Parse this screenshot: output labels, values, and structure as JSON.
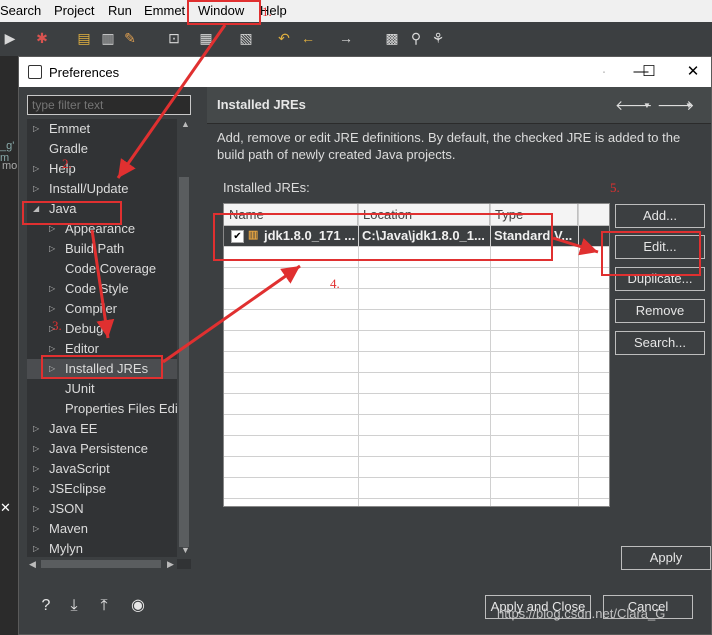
{
  "menubar": {
    "items": [
      "Search",
      "Project",
      "Run",
      "Emmet",
      "Window",
      "Help"
    ]
  },
  "toolbar": {
    "icons": [
      "debug-icon",
      "open-icon",
      "pencil-icon",
      "back-icon",
      "forward-icon",
      "pin-icon"
    ]
  },
  "ide_left": {
    "label_1": "_g' m",
    "label_2": "mo"
  },
  "dialog": {
    "title": "Preferences",
    "filter_placeholder": "type filter text",
    "tree": [
      {
        "label": "Emmet",
        "expand": "▷"
      },
      {
        "label": "Gradle",
        "expand": ""
      },
      {
        "label": "Help",
        "expand": "▷"
      },
      {
        "label": "Install/Update",
        "expand": "▷"
      },
      {
        "label": "Java",
        "expand": "◢"
      },
      {
        "label": "Appearance",
        "expand": "▷"
      },
      {
        "label": "Build Path",
        "expand": "▷"
      },
      {
        "label": "Code Coverage",
        "expand": ""
      },
      {
        "label": "Code Style",
        "expand": "▷"
      },
      {
        "label": "Compiler",
        "expand": "▷"
      },
      {
        "label": "Debug",
        "expand": "▷"
      },
      {
        "label": "Editor",
        "expand": "▷"
      },
      {
        "label": "Installed JREs",
        "expand": "▷"
      },
      {
        "label": "JUnit",
        "expand": ""
      },
      {
        "label": "Properties Files Edi",
        "expand": ""
      },
      {
        "label": "Java EE",
        "expand": "▷"
      },
      {
        "label": "Java Persistence",
        "expand": "▷"
      },
      {
        "label": "JavaScript",
        "expand": "▷"
      },
      {
        "label": "JSEclipse",
        "expand": "▷"
      },
      {
        "label": "JSON",
        "expand": "▷"
      },
      {
        "label": "Maven",
        "expand": "▷"
      },
      {
        "label": "Mylyn",
        "expand": "▷"
      }
    ],
    "page_title": "Installed JREs",
    "description": "Add, remove or edit JRE definitions. By default, the checked JRE is added to the build path of newly created Java projects.",
    "jres_label": "Installed JREs:",
    "columns": [
      "Name",
      "Location",
      "Type"
    ],
    "jre": {
      "name": "jdk1.8.0_171 ...",
      "location": "C:\\Java\\jdk1.8.0_1...",
      "type": "Standard V..."
    },
    "buttons": {
      "add": "Add...",
      "edit": "Edit...",
      "duplicate": "Duplicate...",
      "remove": "Remove",
      "search": "Search...",
      "apply": "Apply",
      "apply_close": "Apply and Close",
      "cancel": "Cancel"
    }
  },
  "annotations": [
    "1.",
    "2.",
    "3.",
    "4.",
    "5."
  ],
  "watermark": "https://blog.csdn.net/Clara_G"
}
